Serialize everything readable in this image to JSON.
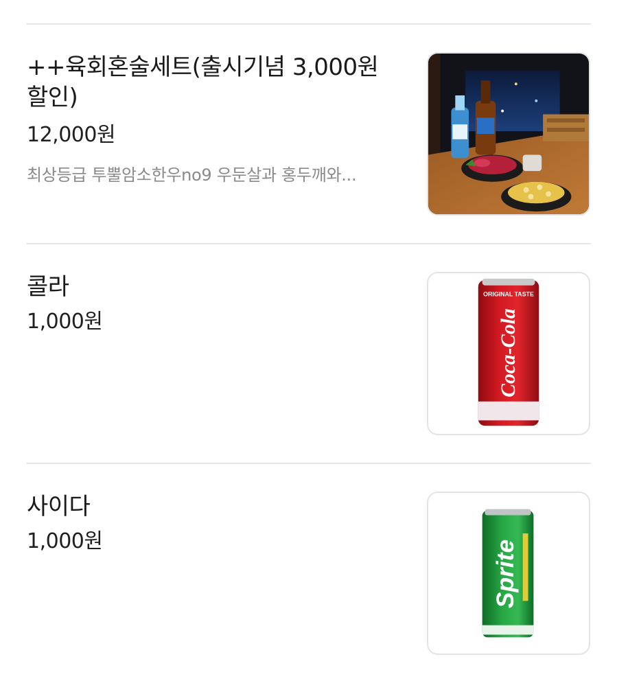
{
  "menu": {
    "items": [
      {
        "name": "++육회혼술세트(출시기념 3,000원할인)",
        "price": "12,000원",
        "description": "최상등급 투뿔암소한우no9 우둔살과 홍두깨와...",
        "image_icon": "yukhoe-set-photo"
      },
      {
        "name": "콜라",
        "price": "1,000원",
        "image_icon": "coca-cola-can-photo",
        "image_text": {
          "top": "ORIGINAL TASTE",
          "brand": "Coca-Cola"
        }
      },
      {
        "name": "사이다",
        "price": "1,000원",
        "image_icon": "sprite-can-photo",
        "image_text": {
          "brand": "Sprite"
        }
      }
    ]
  },
  "colors": {
    "divider": "#e6e6e6",
    "text_primary": "#1a1a1a",
    "text_secondary": "#8a8a8a",
    "cola_red": "#c4141c",
    "sprite_green": "#1f9a3a"
  }
}
